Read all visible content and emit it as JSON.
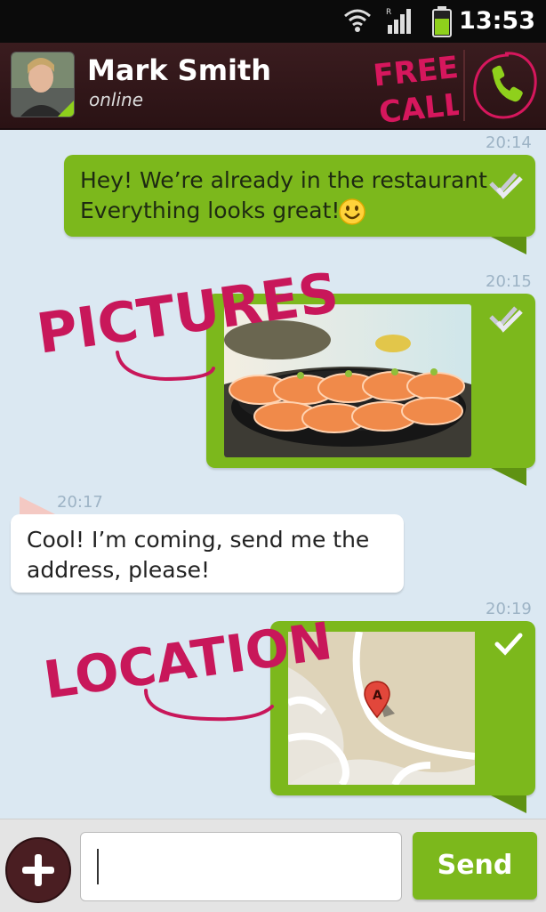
{
  "status_bar": {
    "time": "13:53"
  },
  "header": {
    "contact_name": "Mark Smith",
    "contact_status": "online",
    "free_call_line1": "FREE",
    "free_call_line2": "CALL"
  },
  "messages": [
    {
      "time": "20:14",
      "line1": "Hey! We’re already in the restaurant",
      "line2": "Everything looks great!"
    },
    {
      "time": "20:15",
      "annotation": "PICTURES"
    },
    {
      "time": "20:17",
      "line1": "Cool! I’m coming, send me the",
      "line2": "address, please!"
    },
    {
      "time": "20:19",
      "annotation": "LOCATION"
    }
  ],
  "input": {
    "send_label": "Send",
    "placeholder": ""
  },
  "colors": {
    "accent_green": "#7cb81c",
    "header_bg": "#2f1416",
    "chat_bg": "#dbe8f2",
    "annotation": "#c8175a"
  }
}
